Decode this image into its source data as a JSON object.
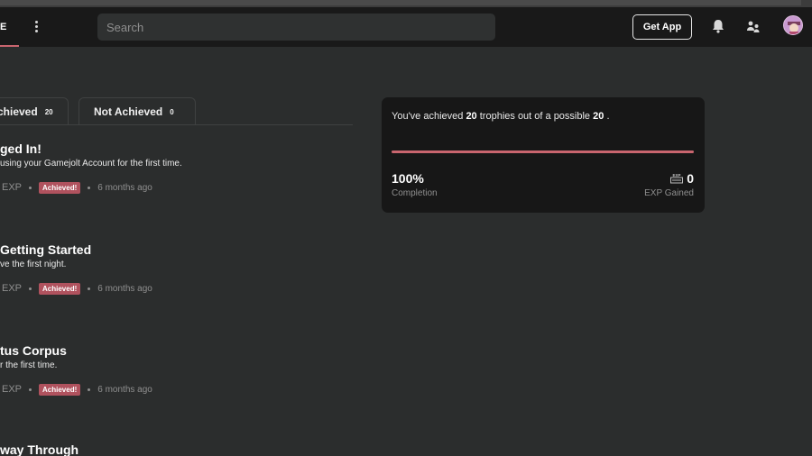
{
  "nav": {
    "section_label": "E",
    "search_placeholder": "Search",
    "get_app_label": "Get App"
  },
  "tabs": [
    {
      "label": "chieved",
      "count": "20"
    },
    {
      "label": "Not Achieved",
      "count": "0"
    }
  ],
  "trophies": [
    {
      "title": "ged In!",
      "description": "using your Gamejolt Account for the first time.",
      "exp": "EXP",
      "badge": "Achieved!",
      "time": "6 months ago"
    },
    {
      "title": "Getting Started",
      "description": "ve the first night.",
      "exp": "EXP",
      "badge": "Achieved!",
      "time": "6 months ago"
    },
    {
      "title": "tus Corpus",
      "description": "r the first time.",
      "exp": "EXP",
      "badge": "Achieved!",
      "time": "6 months ago"
    },
    {
      "title": "way Through",
      "description": "",
      "exp": "",
      "badge": "",
      "time": ""
    }
  ],
  "summary": {
    "prefix": "You've achieved",
    "achieved": "20",
    "middle": "trophies out of a possible",
    "total": "20",
    "suffix": ".",
    "completion_value": "100%",
    "completion_label": "Completion",
    "completion_fraction": 1.0,
    "exp_icon_text": "EXP",
    "exp_value": "0",
    "exp_label": "EXP Gained"
  },
  "colors": {
    "accent": "#c9656e",
    "badge": "#b0525e",
    "background": "#2b2d2d",
    "navbar": "#191919",
    "card": "#171717"
  }
}
